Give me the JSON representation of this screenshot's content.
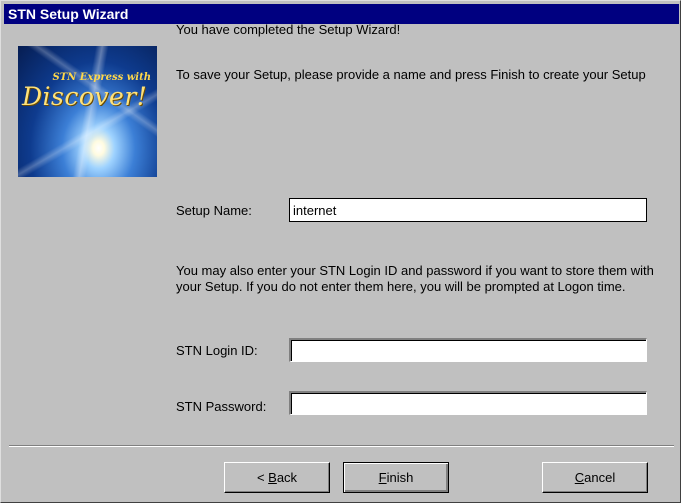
{
  "window": {
    "title": "STN Setup Wizard"
  },
  "logo": {
    "line1": "STN Express with",
    "line2": "Discover!"
  },
  "content": {
    "completed_text": "You have completed the Setup Wizard!",
    "instruction_text": "To save your Setup, please provide a name and press Finish to create your Setup",
    "setup_name_label": "Setup Name:",
    "setup_name_value": "internet",
    "login_info_text": "You may also enter your STN Login ID and password if you want to store them with your Setup.  If you do not enter them here, you will be prompted at Logon time.",
    "login_id_label": "STN Login ID:",
    "login_id_value": "",
    "password_label": "STN Password:",
    "password_value": ""
  },
  "buttons": {
    "back_prefix": "< ",
    "back_mnemonic": "B",
    "back_rest": "ack",
    "finish_mnemonic": "F",
    "finish_rest": "inish",
    "cancel_mnemonic": "C",
    "cancel_rest": "ancel"
  },
  "colors": {
    "titlebar": "#000080",
    "dialog": "#c0c0c0"
  }
}
